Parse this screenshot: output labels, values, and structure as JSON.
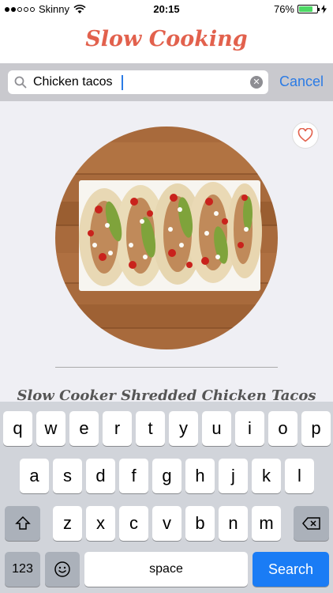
{
  "status": {
    "carrier": "Skinny",
    "time": "20:15",
    "battery_pct": "76%",
    "battery_fraction": 0.76
  },
  "header": {
    "title": "Slow Cooking"
  },
  "search": {
    "value": "Chicken tacos",
    "cancel_label": "Cancel"
  },
  "recipe": {
    "title": "Slow Cooker Shredded Chicken Tacos"
  },
  "keyboard": {
    "row1": [
      "q",
      "w",
      "e",
      "r",
      "t",
      "y",
      "u",
      "i",
      "o",
      "p"
    ],
    "row2": [
      "a",
      "s",
      "d",
      "f",
      "g",
      "h",
      "j",
      "k",
      "l"
    ],
    "row3": [
      "z",
      "x",
      "c",
      "v",
      "b",
      "n",
      "m"
    ],
    "numbers_label": "123",
    "space_label": "space",
    "search_label": "Search"
  },
  "colors": {
    "accent": "#e2614d",
    "link": "#2b7be5",
    "search_key": "#1a7cf5"
  },
  "icons": [
    "wifi-icon",
    "battery-icon",
    "charging-icon",
    "search-icon",
    "clear-icon",
    "heart-icon",
    "shift-icon",
    "backspace-icon",
    "emoji-icon"
  ]
}
